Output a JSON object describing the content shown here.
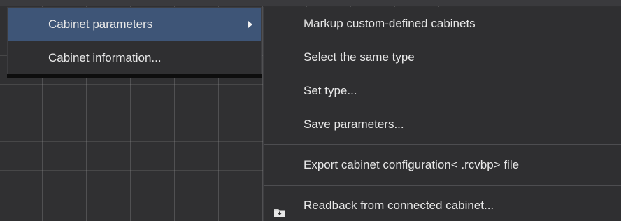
{
  "context_menu": {
    "items": [
      {
        "label": "Cabinet parameters",
        "has_submenu": true,
        "highlighted": true
      },
      {
        "label": "Cabinet information...",
        "has_submenu": false,
        "highlighted": false
      }
    ]
  },
  "submenu": {
    "items": [
      {
        "label": "Markup custom-defined cabinets"
      },
      {
        "label": "Select the same type"
      },
      {
        "label": "Set type..."
      },
      {
        "label": "Save parameters..."
      },
      {
        "label": "Export cabinet configuration< .rcvbp> file"
      },
      {
        "label": "Readback from connected cabinet...",
        "icon": "folder-download-icon"
      }
    ]
  },
  "colors": {
    "menu_background": "#2f2f31",
    "highlight": "#3e5577",
    "text": "#e8e8e8",
    "divider": "#4d4d50"
  }
}
